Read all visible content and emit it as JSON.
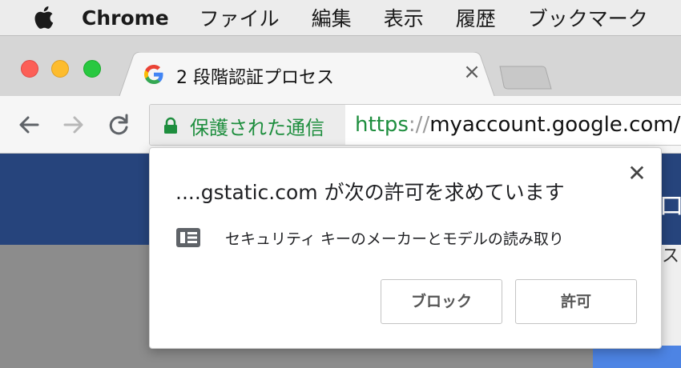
{
  "menubar": {
    "items": [
      "Chrome",
      "ファイル",
      "編集",
      "表示",
      "履歴",
      "ブックマーク"
    ]
  },
  "tab": {
    "title": "2 段階認証プロセス",
    "close": "×"
  },
  "toolbar": {
    "secure_label": "保護された通信",
    "url_scheme": "https",
    "url_sep": "://",
    "url_host": "myaccount.google.com/g"
  },
  "page": {
    "header_glyph": "ロ",
    "side_text": "ス"
  },
  "popup": {
    "title": "....gstatic.com が次の許可を求めています",
    "permission_text": "セキュリティ キーのメーカーとモデルの読み取り",
    "close": "✕",
    "block_label": "ブロック",
    "allow_label": "許可"
  },
  "colors": {
    "secure_green": "#1e8e3e",
    "page_header_blue": "#26447c",
    "page_button_blue": "#4d84e4"
  },
  "icons": {
    "apple": "apple-icon",
    "favicon": "google-g-icon",
    "lock": "lock-icon",
    "permission": "usb-key-icon"
  }
}
